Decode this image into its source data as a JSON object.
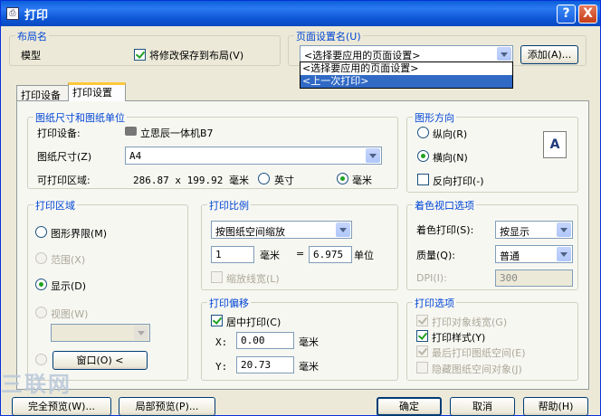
{
  "title": "打印",
  "title_buttons": {
    "help": "?",
    "close": "X"
  },
  "layout": {
    "group_label": "布局名",
    "name": "模型",
    "save_checkbox": "将修改保存到布局(V)",
    "save_checked": true
  },
  "page_setup": {
    "group_label": "页面设置名(U)",
    "combo_value": "<选择要应用的页面设置>",
    "add_button": "添加(A)...",
    "dropdown_items": [
      "<选择要应用的页面设置>",
      "<上一次打印>"
    ],
    "dropdown_selected_index": 1
  },
  "tabs": [
    "打印设备",
    "打印设置"
  ],
  "active_tab": 1,
  "paper": {
    "group_label": "图纸尺寸和图纸单位",
    "device_label": "打印设备:",
    "device_value": "立思辰一体机B7",
    "size_label": "图纸尺寸(Z)",
    "size_value": "A4",
    "printable_label": "可打印区域:",
    "printable_value": "286.87 x 199.92 毫米",
    "unit_inch": "英寸",
    "unit_mm": "毫米",
    "unit_selected": "mm"
  },
  "orientation": {
    "group_label": "图形方向",
    "portrait": "纵向(R)",
    "landscape": "横向(N)",
    "selected": "landscape",
    "reverse": "反向打印(-)",
    "reverse_checked": false,
    "preview_letter": "A"
  },
  "area": {
    "group_label": "打印区域",
    "options": [
      "图形界限(M)",
      "范围(X)",
      "显示(D)",
      "视图(W)"
    ],
    "enabled": [
      true,
      false,
      true,
      false
    ],
    "selected_index": 2,
    "window_button": "窗口(O) <"
  },
  "scale": {
    "group_label": "打印比例",
    "mode": "按图纸空间缩放",
    "value1": "1",
    "unit1": "毫米",
    "equals": "=",
    "value2": "6.975",
    "unit2": "单位",
    "lineweight": "缩放线宽(L)"
  },
  "offset": {
    "group_label": "打印偏移",
    "center": "居中打印(C)",
    "center_checked": true,
    "x_label": "X:",
    "x_value": "0.00",
    "x_unit": "毫米",
    "y_label": "Y:",
    "y_value": "20.73",
    "y_unit": "毫米"
  },
  "shaded": {
    "group_label": "着色视口选项",
    "shade_label": "着色打印(S):",
    "shade_value": "按显示",
    "quality_label": "质量(Q):",
    "quality_value": "普通",
    "dpi_label": "DPI(I):",
    "dpi_value": "300"
  },
  "options": {
    "group_label": "打印选项",
    "items": [
      "打印对象线宽(G)",
      "打印样式(Y)",
      "最后打印图纸空间(E)",
      "隐藏图纸空间对象(J)"
    ],
    "checked": [
      true,
      true,
      true,
      false
    ],
    "enabled": [
      false,
      true,
      false,
      false
    ]
  },
  "footer": {
    "full_preview": "完全预览(W)...",
    "partial_preview": "局部预览(P)...",
    "ok": "确定",
    "cancel": "取消",
    "help": "帮助(H)"
  },
  "watermark": "三联网"
}
